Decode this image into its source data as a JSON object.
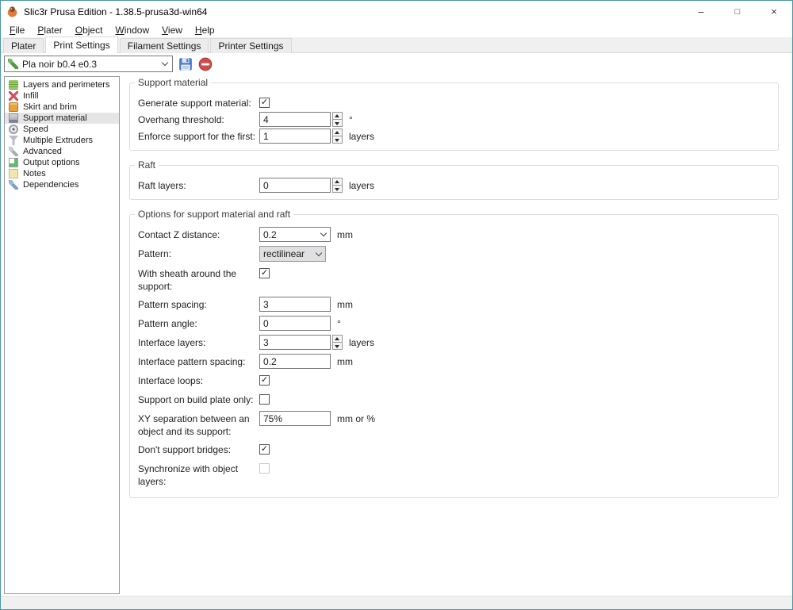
{
  "window": {
    "title": "Slic3r Prusa Edition - 1.38.5-prusa3d-win64",
    "controls": {
      "minimize": "–",
      "maximize": "□",
      "close": "×"
    }
  },
  "colors": {
    "window_border": "#4a97a0",
    "selection_bg": "#e5e5e5",
    "save_icon_blue": "#4a7bc8",
    "delete_icon_red": "#d14b47"
  },
  "menu": {
    "items": [
      {
        "label": "File"
      },
      {
        "label": "Plater"
      },
      {
        "label": "Object"
      },
      {
        "label": "Window"
      },
      {
        "label": "View"
      },
      {
        "label": "Help"
      }
    ]
  },
  "tabs": [
    {
      "label": "Plater",
      "active": false
    },
    {
      "label": "Print Settings",
      "active": true
    },
    {
      "label": "Filament Settings",
      "active": false
    },
    {
      "label": "Printer Settings",
      "active": false
    }
  ],
  "toolbar": {
    "preset_value": "Pla noir b0.4 e0.3",
    "icons": {
      "preset": "wrench-icon",
      "save": "save-preset-icon",
      "delete": "delete-preset-icon"
    }
  },
  "sidebar": {
    "items": [
      {
        "label": "Layers and perimeters",
        "icon": "layers-icon",
        "selected": false
      },
      {
        "label": "Infill",
        "icon": "infill-icon",
        "selected": false
      },
      {
        "label": "Skirt and brim",
        "icon": "skirt-icon",
        "selected": false
      },
      {
        "label": "Support material",
        "icon": "support-icon",
        "selected": true
      },
      {
        "label": "Speed",
        "icon": "speed-icon",
        "selected": false
      },
      {
        "label": "Multiple Extruders",
        "icon": "extruders-icon",
        "selected": false
      },
      {
        "label": "Advanced",
        "icon": "advanced-icon",
        "selected": false
      },
      {
        "label": "Output options",
        "icon": "output-icon",
        "selected": false
      },
      {
        "label": "Notes",
        "icon": "notes-icon",
        "selected": false
      },
      {
        "label": "Dependencies",
        "icon": "dependencies-icon",
        "selected": false
      }
    ]
  },
  "sections": [
    {
      "title": "Support material",
      "rows": [
        {
          "label": "Generate support material:",
          "type": "checkbox",
          "checked": true
        },
        {
          "label": "Overhang threshold:",
          "type": "spin",
          "value": "4",
          "unit": "°"
        },
        {
          "label": "Enforce support for the first:",
          "type": "spin",
          "value": "1",
          "unit": "layers"
        }
      ]
    },
    {
      "title": "Raft",
      "rows": [
        {
          "label": "Raft layers:",
          "type": "spin",
          "value": "0",
          "unit": "layers"
        }
      ]
    },
    {
      "title": "Options for support material and raft",
      "rows": [
        {
          "label": "Contact Z distance:",
          "type": "combo-edit",
          "value": "0.2",
          "unit": "mm"
        },
        {
          "label": "Pattern:",
          "type": "combo",
          "value": "rectilinear"
        },
        {
          "label": "With sheath around the support:",
          "type": "checkbox",
          "checked": true
        },
        {
          "label": "Pattern spacing:",
          "type": "text",
          "value": "3",
          "unit": "mm"
        },
        {
          "label": "Pattern angle:",
          "type": "text",
          "value": "0",
          "unit": "°"
        },
        {
          "label": "Interface layers:",
          "type": "spin",
          "value": "3",
          "unit": "layers"
        },
        {
          "label": "Interface pattern spacing:",
          "type": "text",
          "value": "0.2",
          "unit": "mm"
        },
        {
          "label": "Interface loops:",
          "type": "checkbox",
          "checked": true
        },
        {
          "label": "Support on build plate only:",
          "type": "checkbox",
          "checked": false
        },
        {
          "label": "XY separation between an object and its support:",
          "type": "text",
          "value": "75%",
          "unit": "mm or %"
        },
        {
          "label": "Don't support bridges:",
          "type": "checkbox",
          "checked": true
        },
        {
          "label": "Synchronize with object layers:",
          "type": "checkbox",
          "checked": false,
          "disabled": true
        }
      ]
    }
  ]
}
